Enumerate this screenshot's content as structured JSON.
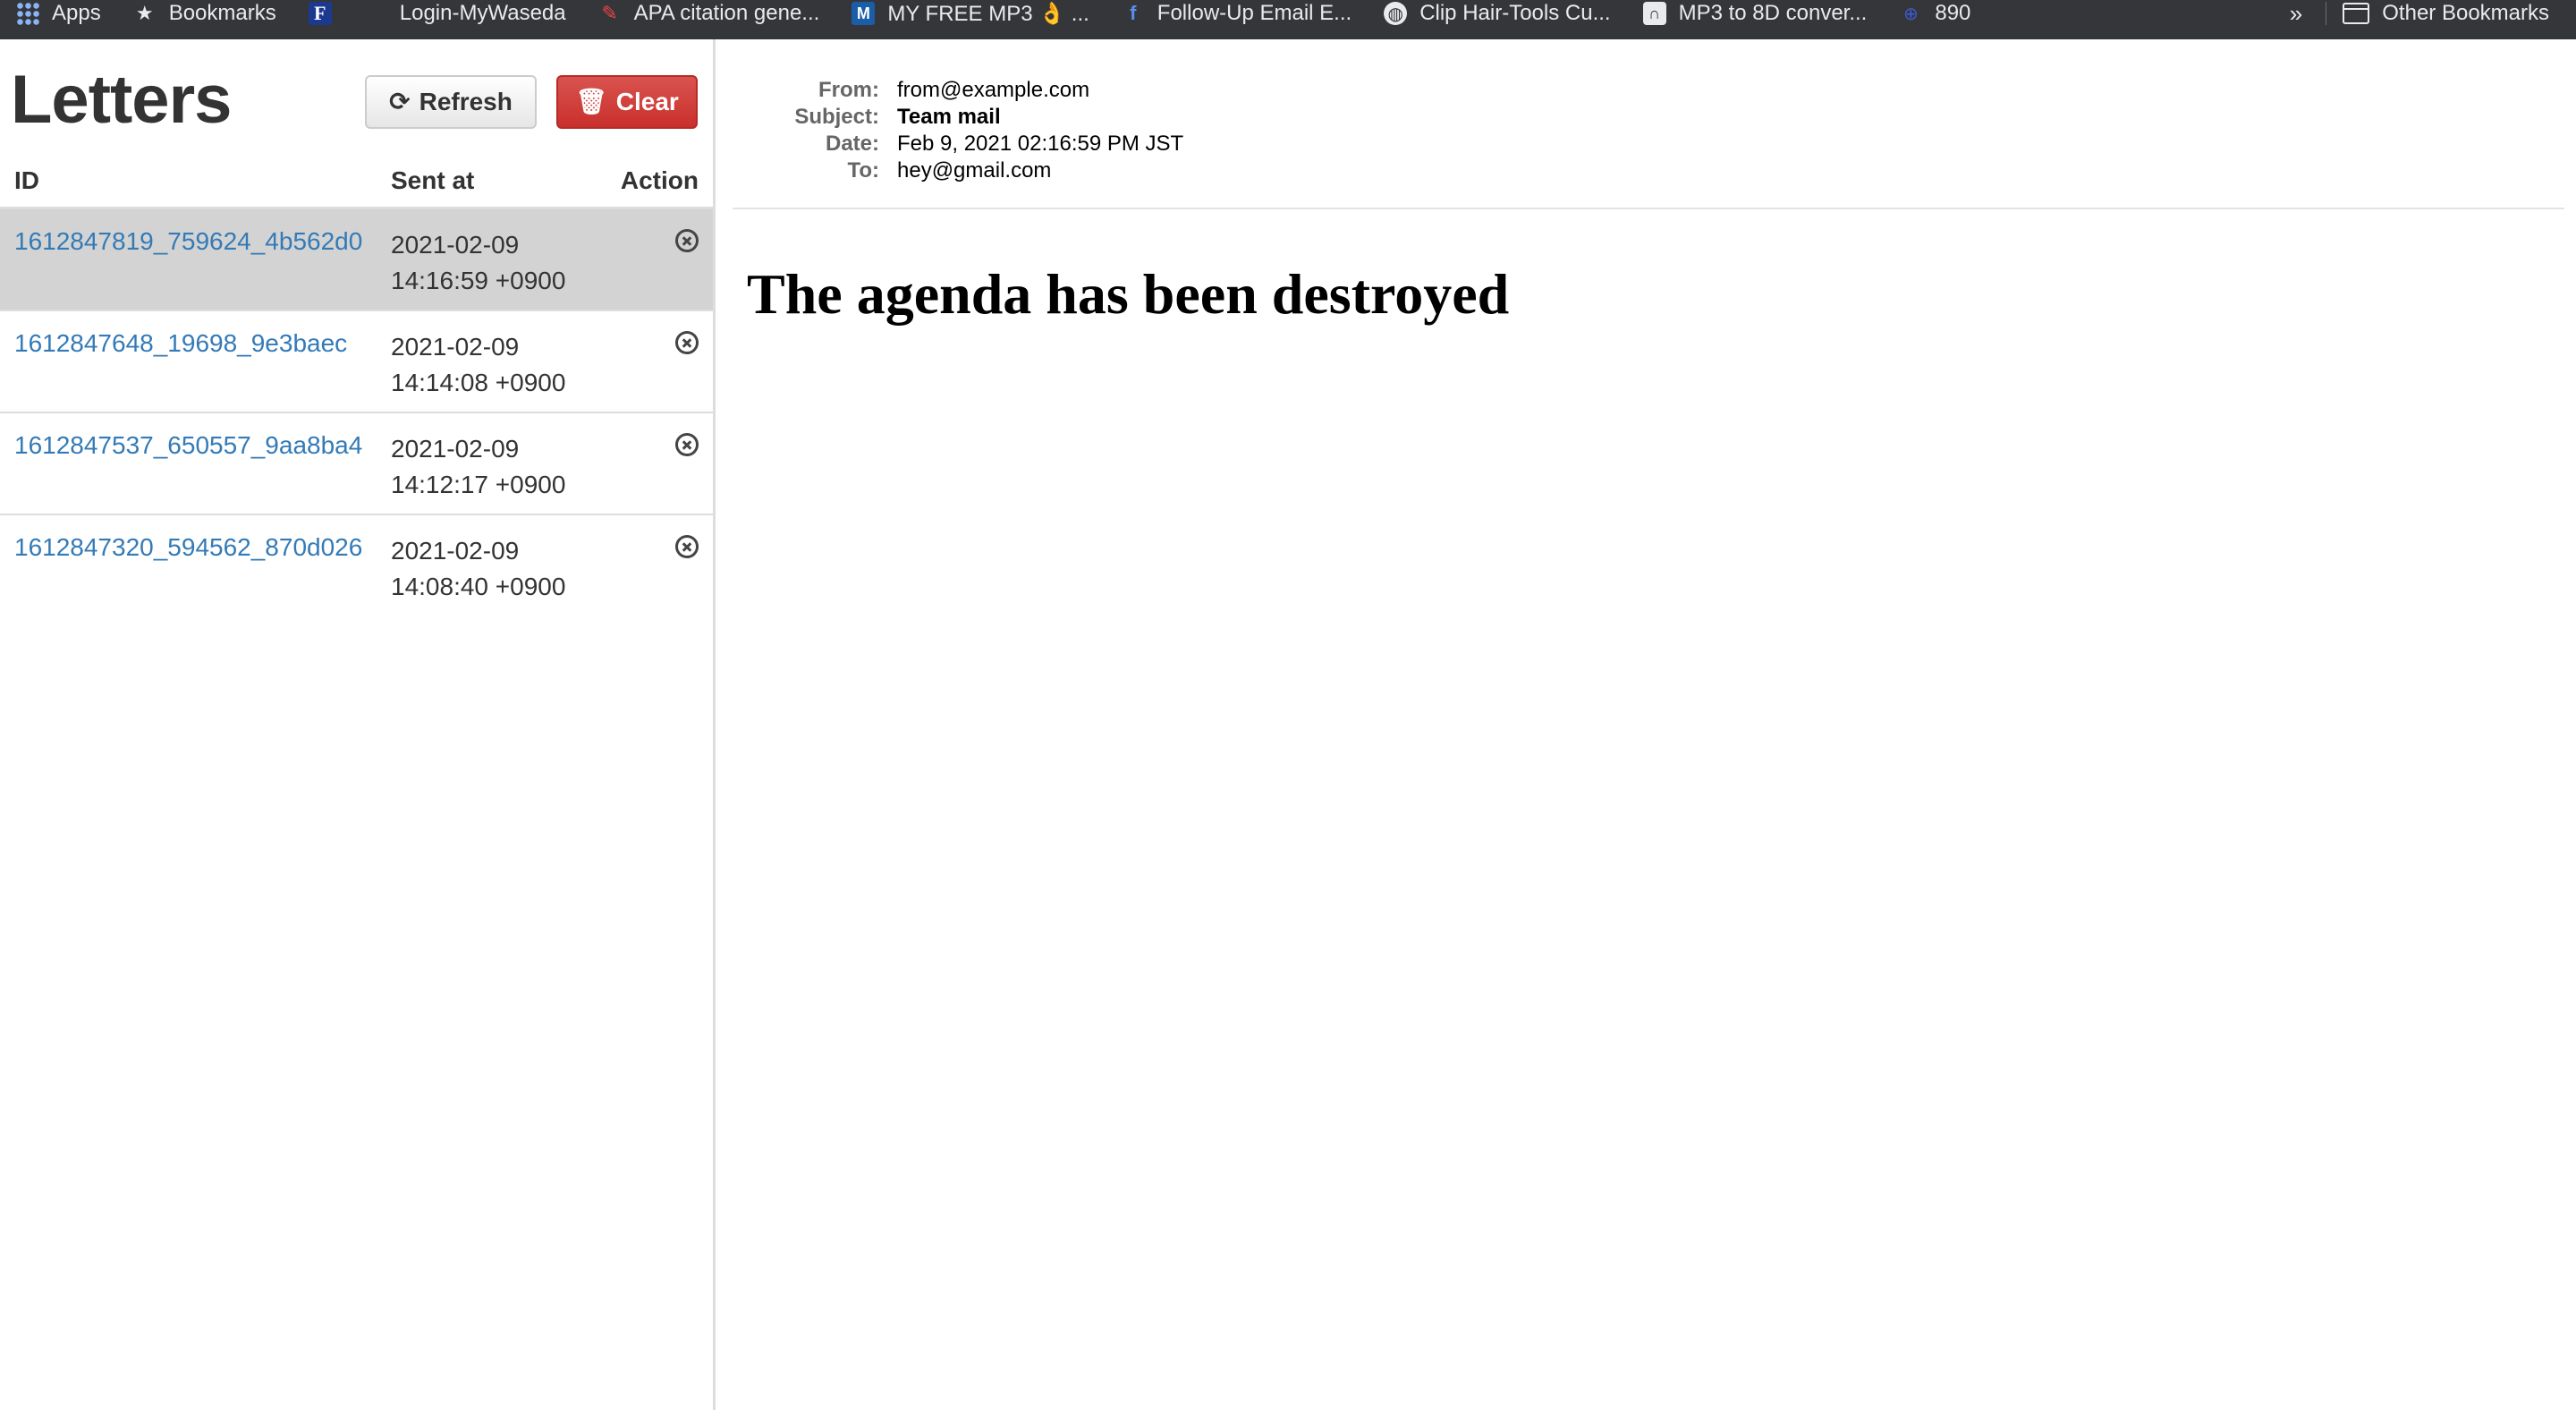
{
  "bookmarks": {
    "items": [
      {
        "label": "Apps",
        "icon": "apps-grid-icon"
      },
      {
        "label": "Bookmarks",
        "icon": "star-icon"
      },
      {
        "label": "",
        "icon": "f-logo-icon"
      },
      {
        "label": "Login-MyWaseda",
        "icon": "blank-icon"
      },
      {
        "label": "APA citation gene...",
        "icon": "apa-icon"
      },
      {
        "label": "MY FREE MP3 👌 ...",
        "icon": "m-logo-icon"
      },
      {
        "label": "Follow-Up Email E...",
        "icon": "f-icon"
      },
      {
        "label": "Clip Hair-Tools Cu...",
        "icon": "globe-icon"
      },
      {
        "label": "MP3 to 8D conver...",
        "icon": "headphones-icon"
      },
      {
        "label": "890",
        "icon": "site-icon"
      }
    ],
    "overflow": "»",
    "other": "Other Bookmarks"
  },
  "sidebar": {
    "title": "Letters",
    "refresh_label": "Refresh",
    "clear_label": "Clear",
    "columns": {
      "id": "ID",
      "sent": "Sent at",
      "action": "Action"
    },
    "rows": [
      {
        "id": "1612847819_759624_4b562d0",
        "date": "2021-02-09",
        "time": "14:16:59 +0900",
        "selected": true
      },
      {
        "id": "1612847648_19698_9e3baec",
        "date": "2021-02-09",
        "time": "14:14:08 +0900",
        "selected": false
      },
      {
        "id": "1612847537_650557_9aa8ba4",
        "date": "2021-02-09",
        "time": "14:12:17 +0900",
        "selected": false
      },
      {
        "id": "1612847320_594562_870d026",
        "date": "2021-02-09",
        "time": "14:08:40 +0900",
        "selected": false
      }
    ]
  },
  "message": {
    "from_label": "From:",
    "from": "from@example.com",
    "subject_label": "Subject:",
    "subject": "Team mail",
    "date_label": "Date:",
    "date": "Feb 9, 2021 02:16:59 PM JST",
    "to_label": "To:",
    "to": "hey@gmail.com",
    "body": "The agenda has been destroyed"
  },
  "colors": {
    "bookmarks_bg": "#35363a",
    "link": "#337ab7",
    "danger": "#d9534f",
    "selected_row": "#d3d3d3"
  }
}
